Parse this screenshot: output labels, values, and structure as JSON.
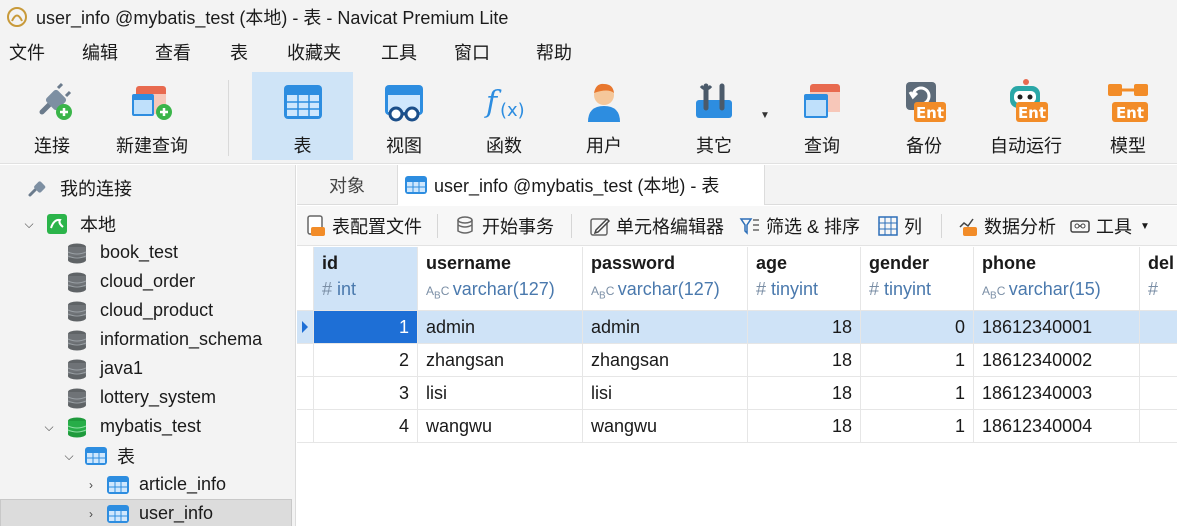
{
  "window": {
    "title": "user_info @mybatis_test (本地) - 表 - Navicat Premium Lite"
  },
  "menu": [
    "文件",
    "编辑",
    "查看",
    "表",
    "收藏夹",
    "工具",
    "窗口",
    "帮助"
  ],
  "toolbar": {
    "connect": "连接",
    "new_query": "新建查询",
    "table": "表",
    "view": "视图",
    "function": "函数",
    "user": "用户",
    "other": "其它",
    "query": "查询",
    "backup": "备份",
    "automation": "自动运行",
    "model": "模型",
    "ent_badge": "Ent"
  },
  "sidebar": {
    "my_connections": "我的连接",
    "local": "本地",
    "databases": [
      "book_test",
      "cloud_order",
      "cloud_product",
      "information_schema",
      "java1",
      "lottery_system"
    ],
    "open_db": "mybatis_test",
    "tables_node": "表",
    "tables": [
      "article_info",
      "user_info"
    ]
  },
  "tabs": {
    "objects": "对象",
    "active": "user_info @mybatis_test (本地) - 表"
  },
  "subtoolbar": {
    "table_profile": "表配置文件",
    "begin_tx": "开始事务",
    "cell_editor": "单元格编辑器",
    "filter_sort": "筛选 & 排序",
    "columns": "列",
    "data_analysis": "数据分析",
    "tools": "工具"
  },
  "grid": {
    "columns": [
      {
        "name": "id",
        "type": "int"
      },
      {
        "name": "username",
        "type": "varchar(127)"
      },
      {
        "name": "password",
        "type": "varchar(127)"
      },
      {
        "name": "age",
        "type": "tinyint"
      },
      {
        "name": "gender",
        "type": "tinyint"
      },
      {
        "name": "phone",
        "type": "varchar(15)"
      },
      {
        "name": "del",
        "type": ""
      }
    ],
    "rows": [
      [
        "1",
        "admin",
        "admin",
        "18",
        "0",
        "18612340001"
      ],
      [
        "2",
        "zhangsan",
        "zhangsan",
        "18",
        "1",
        "18612340002"
      ],
      [
        "3",
        "lisi",
        "lisi",
        "18",
        "1",
        "18612340003"
      ],
      [
        "4",
        "wangwu",
        "wangwu",
        "18",
        "1",
        "18612340004"
      ]
    ]
  },
  "colors": {
    "accent": "#1e6fd6",
    "selection": "#cfe3f7",
    "type_text": "#4a79ad"
  }
}
